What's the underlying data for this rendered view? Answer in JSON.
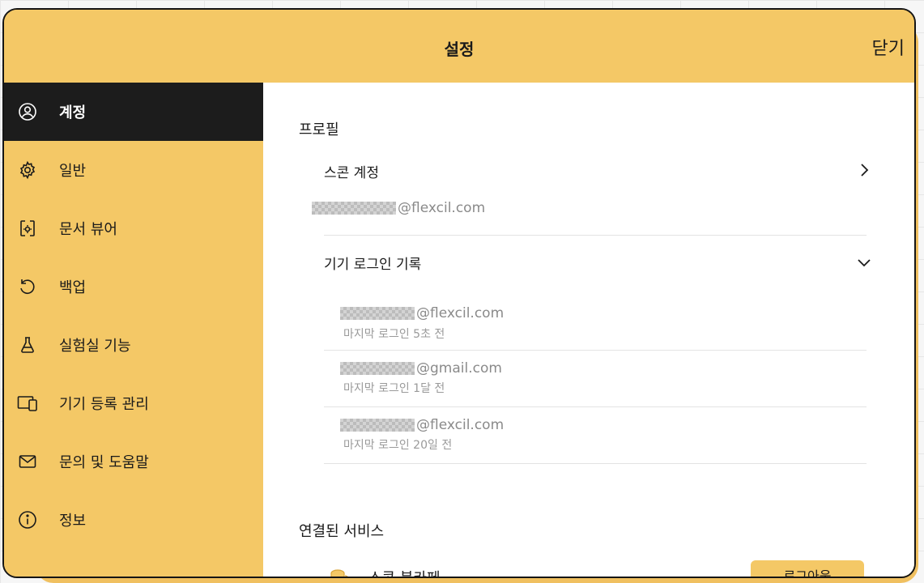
{
  "window": {
    "title": "설정",
    "close_label": "닫기"
  },
  "sidebar": {
    "items": [
      {
        "label": "계정",
        "icon": "user-circle-icon",
        "active": true
      },
      {
        "label": "일반",
        "icon": "gear-icon"
      },
      {
        "label": "문서 뷰어",
        "icon": "document-settings-icon"
      },
      {
        "label": "백업",
        "icon": "backup-icon"
      },
      {
        "label": "실험실 기능",
        "icon": "flask-icon"
      },
      {
        "label": "기기 등록 관리",
        "icon": "devices-icon"
      },
      {
        "label": "문의 및 도움말",
        "icon": "mail-icon"
      },
      {
        "label": "정보",
        "icon": "info-icon"
      }
    ]
  },
  "profile": {
    "section_title": "프로필",
    "account_label": "스콘 계정",
    "account_email": "@flexcil.com",
    "login_history_label": "기기 로그인 기록",
    "login_history": [
      {
        "email": "@flexcil.com",
        "last_login": "마지막 로그인 5초 전"
      },
      {
        "email": "@gmail.com",
        "last_login": "마지막 로그인 1달 전"
      },
      {
        "email": "@flexcil.com",
        "last_login": "마지막 로그인 20일 전"
      }
    ]
  },
  "services": {
    "section_title": "연결된 서비스",
    "items": [
      {
        "label": "스콘 북카페",
        "action_label": "로그아웃",
        "icon": "coins-icon"
      }
    ]
  },
  "colors": {
    "accent": "#f4c866",
    "active_bg": "#1c1c1c"
  }
}
